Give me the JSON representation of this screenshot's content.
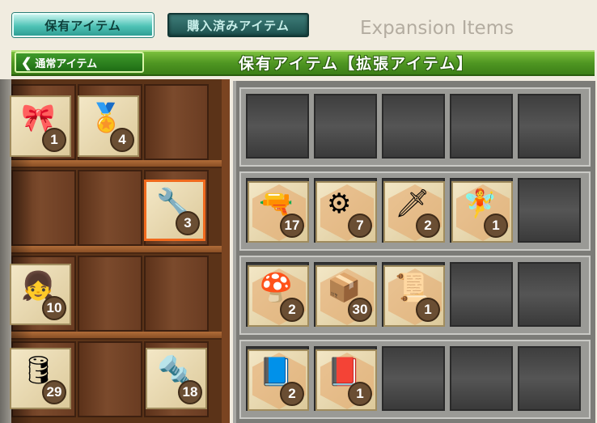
{
  "tabs": {
    "owned_label": "保有アイテム",
    "purchased_label": "購入済みアイテム"
  },
  "page_title": "Expansion Items",
  "header": {
    "back_label": "通常アイテム",
    "title": "保有アイテム【拡張アイテム】"
  },
  "colors": {
    "header_green": "#4f9622",
    "selected_border": "#f06a1e",
    "count_badge": "#6a4e33"
  },
  "wood_items": [
    {
      "icon": "ribbon-icon",
      "glyph": "🎀",
      "count": "1"
    },
    {
      "icon": "medal-icon",
      "glyph": "🏅",
      "count": "4"
    },
    {
      "icon": "repair-girl-icon",
      "glyph": "🔧",
      "count": "3"
    },
    {
      "icon": "girl-portrait-icon",
      "glyph": "👧",
      "count": "10"
    },
    {
      "icon": "drum-can-icon",
      "glyph": "🛢",
      "count": "29"
    },
    {
      "icon": "tools-icon",
      "glyph": "🔩",
      "count": "18"
    }
  ],
  "metal_items": [
    {
      "icon": "turret-icon",
      "glyph": "🔫",
      "count": "17"
    },
    {
      "icon": "engine-icon",
      "glyph": "⚙",
      "count": "7"
    },
    {
      "icon": "torpedo-tubes-icon",
      "glyph": "🗡",
      "count": "2"
    },
    {
      "icon": "fairy-crew-icon",
      "glyph": "🧚",
      "count": "1"
    },
    {
      "icon": "mushroom-icon",
      "glyph": "🍄",
      "count": "2"
    },
    {
      "icon": "supply-crate-icon",
      "glyph": "📦",
      "count": "30"
    },
    {
      "icon": "documents-icon",
      "glyph": "📜",
      "count": "1"
    },
    {
      "icon": "blue-blueprint-icon",
      "glyph": "📘",
      "count": "2"
    },
    {
      "icon": "red-blueprint-icon",
      "glyph": "📕",
      "count": "1"
    }
  ]
}
